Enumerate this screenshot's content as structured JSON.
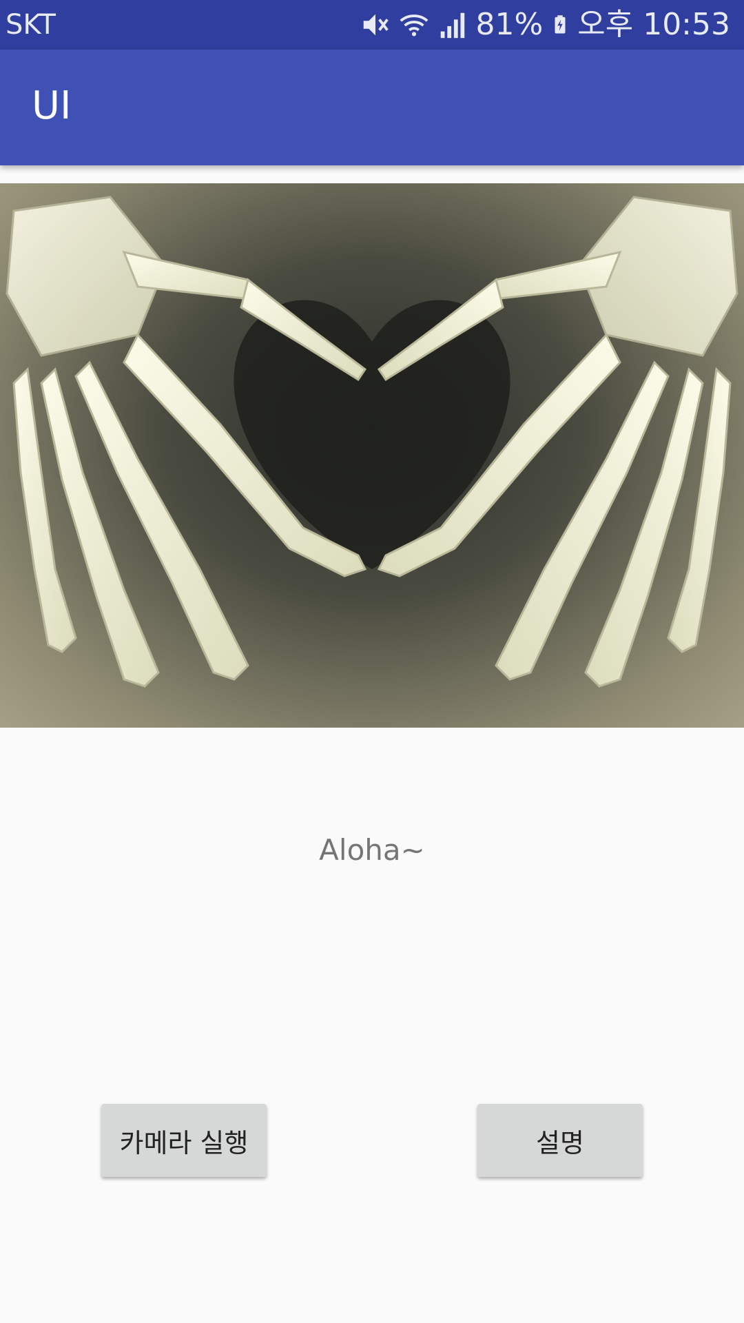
{
  "status_bar": {
    "carrier": "SKT",
    "battery": "81%",
    "time": "오후 10:53",
    "icons": [
      "mute-icon",
      "wifi-icon",
      "signal-icon",
      "battery-charging-icon"
    ]
  },
  "app_bar": {
    "title": "UI",
    "color": "#3f51b5"
  },
  "main": {
    "image_subject": "x-ray hands forming a heart",
    "message": "Aloha~",
    "buttons": {
      "camera_label": "카메라 실행",
      "info_label": "설명"
    }
  },
  "colors": {
    "status_bar": "#303f9f",
    "app_bar": "#3f51b5",
    "background": "#fafafa",
    "button": "#d6d7d7"
  }
}
